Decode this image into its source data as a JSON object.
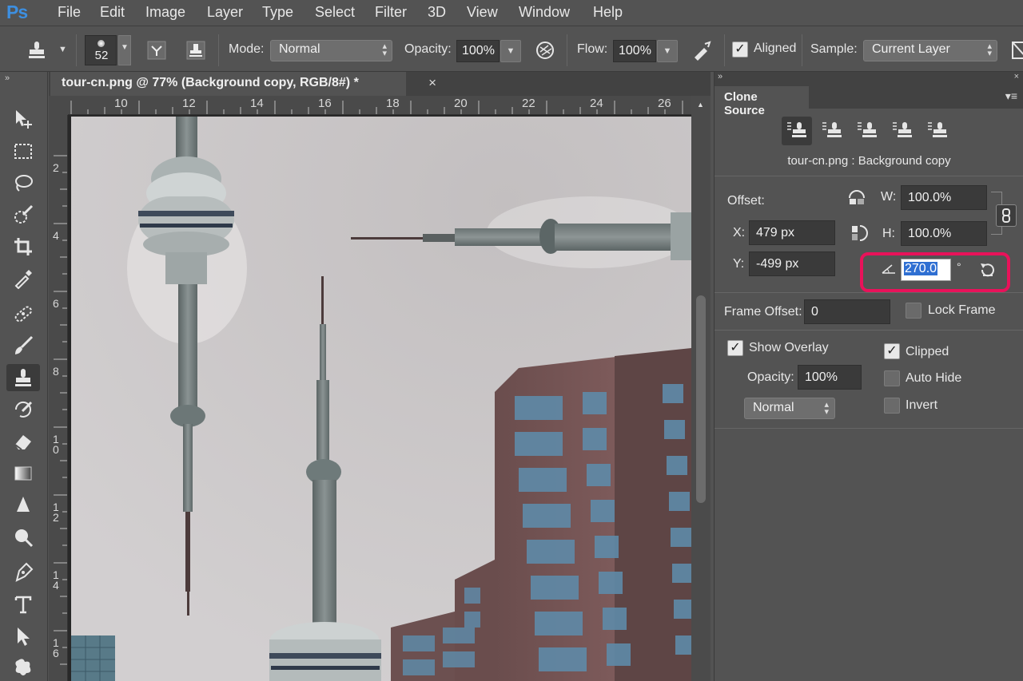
{
  "menubar": {
    "logo": "Ps",
    "items": [
      "File",
      "Edit",
      "Image",
      "Layer",
      "Type",
      "Select",
      "Filter",
      "3D",
      "View",
      "Window",
      "Help"
    ]
  },
  "options": {
    "brush_size": "52",
    "mode_label": "Mode:",
    "mode_value": "Normal",
    "opacity_label": "Opacity:",
    "opacity_value": "100%",
    "flow_label": "Flow:",
    "flow_value": "100%",
    "aligned_label": "Aligned",
    "aligned_checked": true,
    "sample_label": "Sample:",
    "sample_value": "Current Layer"
  },
  "document": {
    "tab_title": "tour-cn.png @ 77% (Background copy, RGB/8#) *",
    "close_glyph": "×",
    "ruler_top": [
      "10",
      "12",
      "14",
      "16",
      "18",
      "20",
      "22",
      "24",
      "26"
    ],
    "ruler_left": [
      "2",
      "4",
      "6",
      "8",
      "1\n0",
      "1\n2",
      "1\n4",
      "1\n6"
    ]
  },
  "panel": {
    "title": "Clone Source",
    "source_name": "tour-cn.png : Background copy",
    "offset_label": "Offset:",
    "w_label": "W:",
    "w_value": "100.0%",
    "h_label": "H:",
    "h_value": "100.0%",
    "x_label": "X:",
    "x_value": "479 px",
    "y_label": "Y:",
    "y_value": "-499 px",
    "angle_value": "270.0",
    "degree": "°",
    "frame_offset_label": "Frame Offset:",
    "frame_offset_value": "0",
    "lock_frame_label": "Lock Frame",
    "show_overlay_label": "Show Overlay",
    "overlay_opacity_label": "Opacity:",
    "overlay_opacity_value": "100%",
    "overlay_mode": "Normal",
    "clipped_label": "Clipped",
    "auto_hide_label": "Auto Hide",
    "invert_label": "Invert",
    "highlight_color": "#e8125a"
  }
}
